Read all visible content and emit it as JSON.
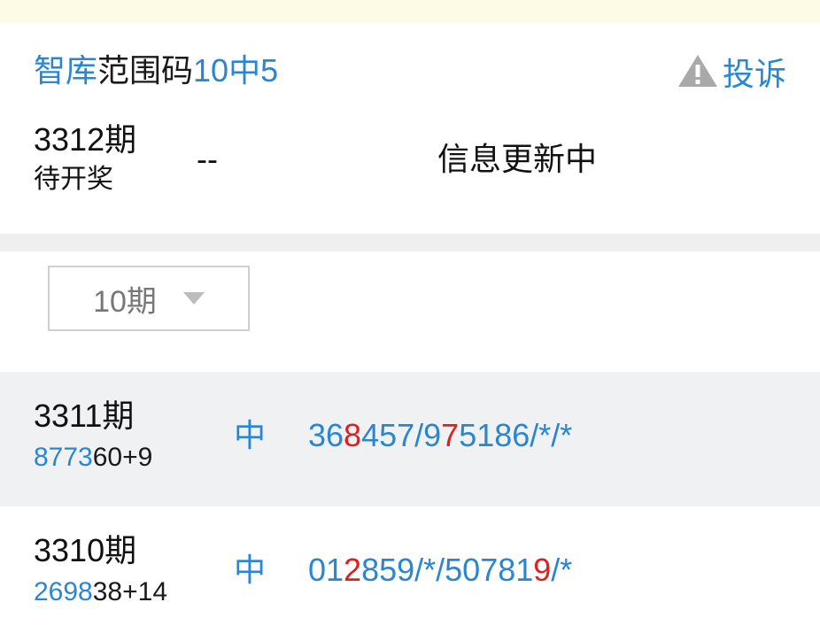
{
  "header": {
    "title_parts": [
      {
        "text": "智库",
        "color": "blue"
      },
      {
        "text": "范围码",
        "color": "dark"
      },
      {
        "text": "10中5",
        "color": "blue"
      }
    ],
    "complain_label": "投诉",
    "complain_icon": "warning-triangle-icon"
  },
  "current": {
    "issue": "3312期",
    "status": "待开奖",
    "dash": "--",
    "info": "信息更新中"
  },
  "filter": {
    "selected": "10期"
  },
  "rows": [
    {
      "issue": "3311期",
      "draw_parts": [
        {
          "text": "8773",
          "color": "blue"
        },
        {
          "text": "60+9",
          "color": "dark"
        }
      ],
      "hit": "中",
      "code_parts": [
        {
          "text": "36",
          "color": "blue"
        },
        {
          "text": "8",
          "color": "red"
        },
        {
          "text": "457/9",
          "color": "blue"
        },
        {
          "text": "7",
          "color": "red"
        },
        {
          "text": "5186/*/*",
          "color": "blue"
        }
      ]
    },
    {
      "issue": "3310期",
      "draw_parts": [
        {
          "text": "2698",
          "color": "blue"
        },
        {
          "text": "38+14",
          "color": "dark"
        }
      ],
      "hit": "中",
      "code_parts": [
        {
          "text": "01",
          "color": "blue"
        },
        {
          "text": "2",
          "color": "red"
        },
        {
          "text": "859/*/50781",
          "color": "blue"
        },
        {
          "text": "9",
          "color": "red"
        },
        {
          "text": "/*",
          "color": "blue"
        }
      ]
    }
  ],
  "colors": {
    "blue": "#2a86d1",
    "red": "#e02020",
    "dark": "#1a1a1a",
    "alt_row": "#f0f1f2"
  }
}
